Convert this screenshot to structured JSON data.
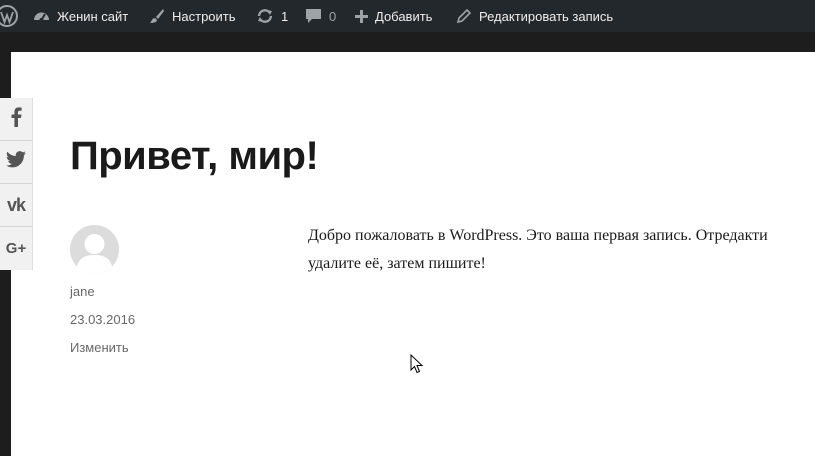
{
  "adminbar": {
    "site_name": "Женин сайт",
    "customize": "Настроить",
    "updates_count": "1",
    "comments_count": "0",
    "add_new": "Добавить",
    "edit_post": "Редактировать запись"
  },
  "share": {
    "buttons": [
      {
        "icon": "facebook-icon",
        "label": "f"
      },
      {
        "icon": "twitter-icon",
        "label": ""
      },
      {
        "icon": "vk-icon",
        "label": "vk"
      },
      {
        "icon": "google-plus-icon",
        "label": "G+"
      }
    ]
  },
  "post": {
    "title": "Привет, мир!",
    "author": "jane",
    "date": "23.03.2016",
    "edit_link": "Изменить",
    "content_line1": "Добро пожаловать в WordPress. Это ваша первая запись. Отредакти",
    "content_line2": "удалите её, затем пишите!"
  },
  "colors": {
    "adminbar_bg": "#23282d",
    "page_bg": "#1d1d1d",
    "sheet_bg": "#ffffff",
    "text": "#1a1a1a",
    "meta": "#686868"
  }
}
